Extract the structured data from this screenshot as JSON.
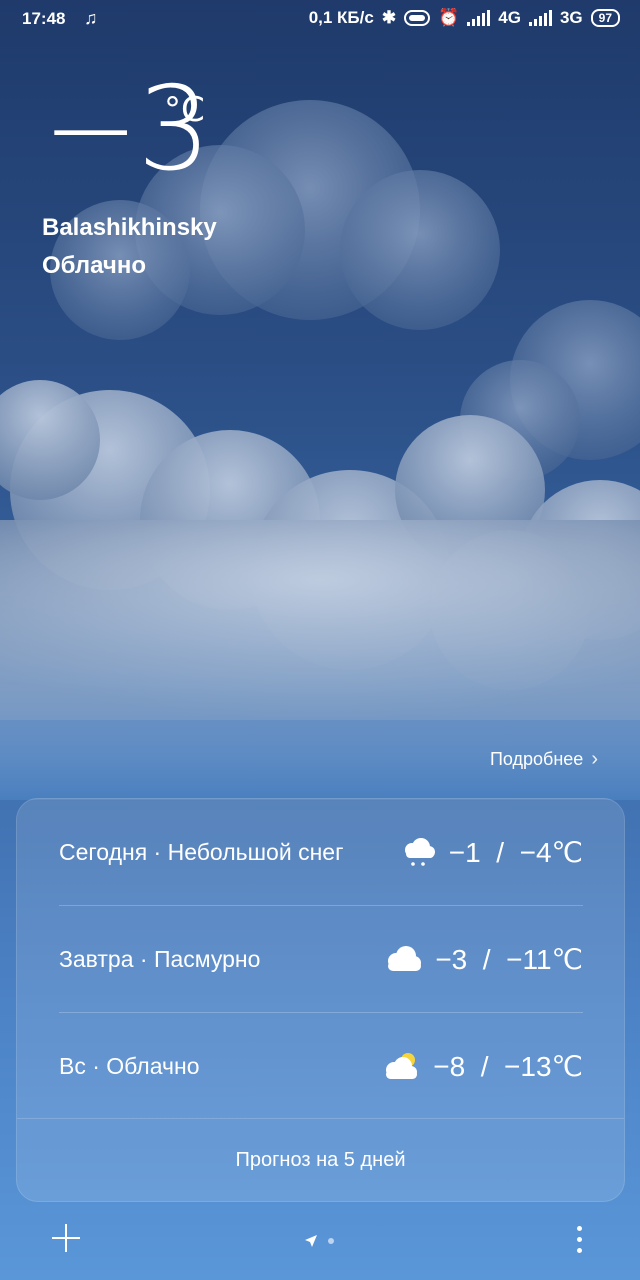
{
  "status_bar": {
    "time": "17:48",
    "network_speed": "0,1 КБ/с",
    "network_1": "4G",
    "network_2": "3G",
    "battery": "97",
    "icons": [
      "music-note-icon",
      "bluetooth-icon",
      "toggle-icon",
      "alarm-icon",
      "signal-icon"
    ]
  },
  "current": {
    "temperature": "−3",
    "unit": "°C",
    "location": "Balashikhinsky",
    "condition": "Облачно"
  },
  "more_link": "Подробнее",
  "forecast": [
    {
      "label": "Сегодня · Небольшой снег",
      "icon": "light-snow-icon",
      "temps": "−1  /  −4℃"
    },
    {
      "label": "Завтра · Пасмурно",
      "icon": "overcast-icon",
      "temps": "−3  /  −11℃"
    },
    {
      "label": "Вс · Облачно",
      "icon": "partly-cloudy-icon",
      "temps": "−8  /  −13℃"
    }
  ],
  "five_day_label": "Прогноз на 5 дней",
  "colors": {
    "bg_top": "#1f3a6b",
    "bg_bottom": "#5a97d8"
  }
}
